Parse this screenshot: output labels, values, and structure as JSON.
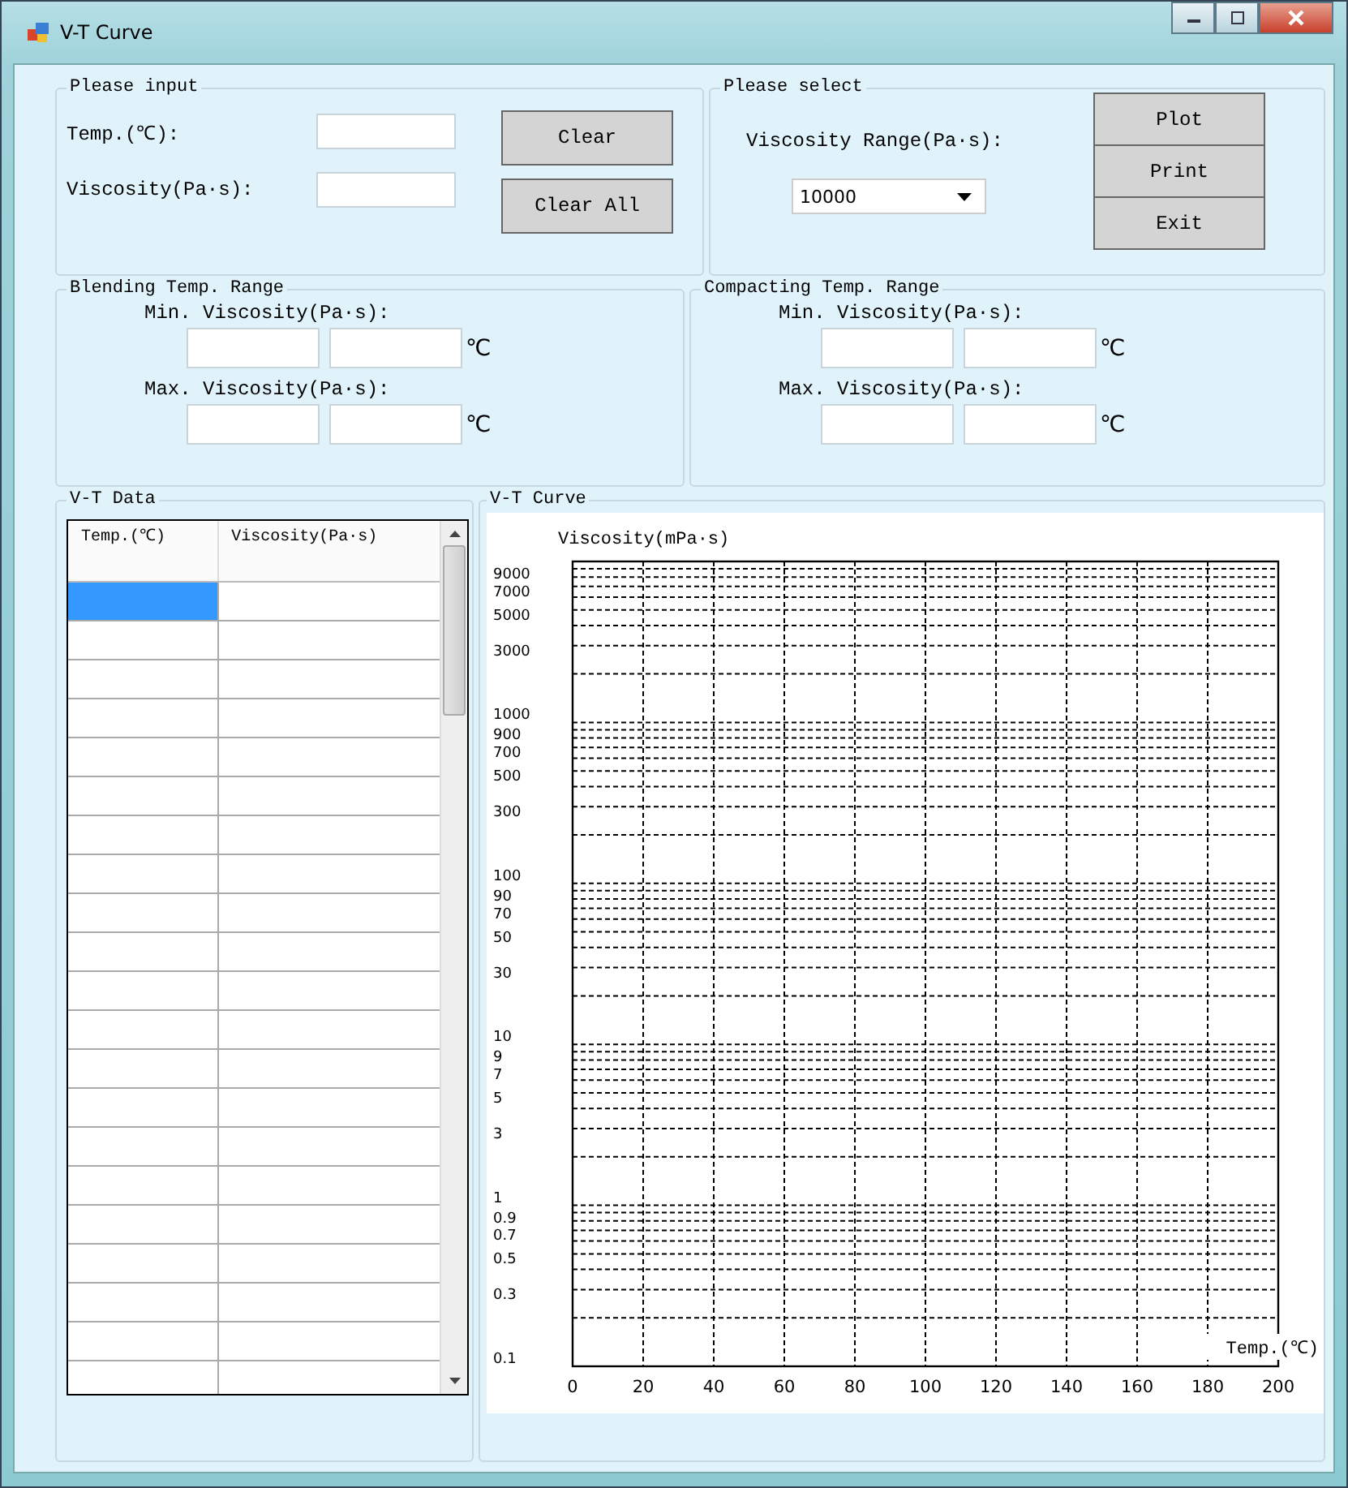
{
  "window": {
    "title": "V-T Curve"
  },
  "input_group": {
    "title": "Please input",
    "fields": [
      {
        "label": "Temp.(℃):"
      },
      {
        "label": "Viscosity(Pa·s):"
      }
    ],
    "buttons": [
      "Clear",
      "Clear All"
    ]
  },
  "select_group": {
    "title": "Please select",
    "label": "Viscosity Range(Pa·s):",
    "dropdown": {
      "value": "10000"
    },
    "buttons": [
      "Plot",
      "Print",
      "Exit"
    ]
  },
  "ranges": [
    {
      "title": "Blending Temp. Range",
      "rows": [
        {
          "label": "Min. Viscosity(Pa·s):",
          "unit": "℃"
        },
        {
          "label": "Max. Viscosity(Pa·s):",
          "unit": "℃"
        }
      ]
    },
    {
      "title": "Compacting Temp. Range",
      "rows": [
        {
          "label": "Min. Viscosity(Pa·s):",
          "unit": "℃"
        },
        {
          "label": "Max. Viscosity(Pa·s):",
          "unit": "℃"
        }
      ]
    }
  ],
  "data_group": {
    "title": "V-T Data",
    "table": {
      "columns": [
        "Temp.(℃)",
        "Viscosity(Pa·s)"
      ],
      "rows": [
        {
          "selected": true
        },
        {
          "selected": false
        },
        {
          "selected": false
        },
        {
          "selected": false
        },
        {
          "selected": false
        },
        {
          "selected": false
        },
        {
          "selected": false
        },
        {
          "selected": false
        },
        {
          "selected": false
        },
        {
          "selected": false
        },
        {
          "selected": false
        },
        {
          "selected": false
        },
        {
          "selected": false
        },
        {
          "selected": false
        },
        {
          "selected": false
        },
        {
          "selected": false
        },
        {
          "selected": false
        },
        {
          "selected": false
        },
        {
          "selected": false
        },
        {
          "selected": false
        },
        {
          "selected": false
        }
      ]
    }
  },
  "curve_group": {
    "title": "V-T Curve",
    "plot": {
      "ylabel": "Viscosity(mPa·s)",
      "xlabel": "Temp.(℃)",
      "y_labels": [
        "9000",
        "7000",
        "5000",
        "3000",
        "1000",
        "900",
        "700",
        "500",
        "300",
        "100",
        "90",
        "70",
        "50",
        "30",
        "10",
        "9",
        "7",
        "5",
        "3",
        "1",
        "0.9",
        "0.7",
        "0.5",
        "0.3",
        "0.1"
      ],
      "x_labels": [
        "0",
        "20",
        "40",
        "60",
        "80",
        "100",
        "120",
        "140",
        "160",
        "180",
        "200"
      ]
    }
  }
}
